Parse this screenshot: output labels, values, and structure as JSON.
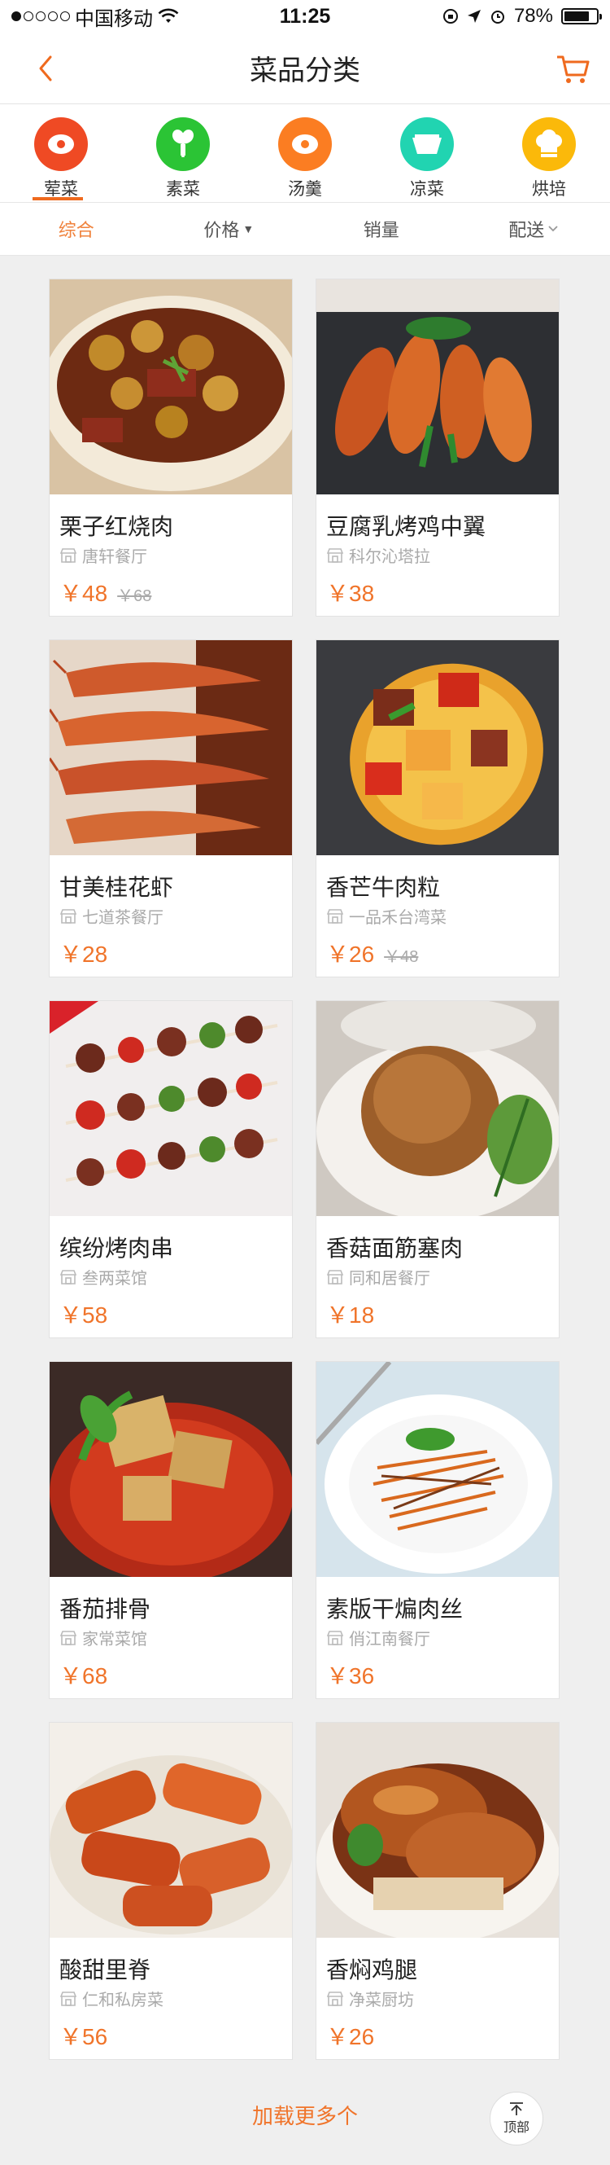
{
  "status": {
    "carrier": "中国移动",
    "time": "11:25",
    "battery": "78%",
    "battery_level": 0.78
  },
  "nav": {
    "title": "菜品分类",
    "back_icon": "chevron-left-icon",
    "cart_icon": "cart-icon",
    "accent": "#ef6a1e"
  },
  "categories": [
    {
      "label": "荤菜",
      "color": "#ef4a24",
      "icon": "meat-icon"
    },
    {
      "label": "素菜",
      "color": "#2bc435",
      "icon": "vegetable-icon"
    },
    {
      "label": "汤羹",
      "color": "#fb7d22",
      "icon": "soup-icon"
    },
    {
      "label": "凉菜",
      "color": "#21d4b1",
      "icon": "bowl-icon"
    },
    {
      "label": "烘培",
      "color": "#fbb90a",
      "icon": "chef-hat-icon"
    }
  ],
  "sort": {
    "items": [
      "综合",
      "价格",
      "销量",
      "配送"
    ],
    "active": "综合"
  },
  "dishes": [
    {
      "name": "栗子红烧肉",
      "shop": "唐轩餐厅",
      "price": "￥48",
      "old": "￥68"
    },
    {
      "name": "豆腐乳烤鸡中翼",
      "shop": "科尔沁塔拉",
      "price": "￥38",
      "old": ""
    },
    {
      "name": "甘美桂花虾",
      "shop": "七道茶餐厅",
      "price": "￥28",
      "old": ""
    },
    {
      "name": "香芒牛肉粒",
      "shop": "一品禾台湾菜",
      "price": "￥26",
      "old": "￥48"
    },
    {
      "name": "缤纷烤肉串",
      "shop": "叁两菜馆",
      "price": "￥58",
      "old": ""
    },
    {
      "name": "香菇面筋塞肉",
      "shop": "同和居餐厅",
      "price": "￥18",
      "old": ""
    },
    {
      "name": "番茄排骨",
      "shop": "家常菜馆",
      "price": "￥68",
      "old": ""
    },
    {
      "name": "素版干煸肉丝",
      "shop": "俏江南餐厅",
      "price": "￥36",
      "old": ""
    },
    {
      "name": "酸甜里脊",
      "shop": "仁和私房菜",
      "price": "￥56",
      "old": ""
    },
    {
      "name": "香焖鸡腿",
      "shop": "净菜厨坊",
      "price": "￥26",
      "old": ""
    }
  ],
  "load_more": "加载更多个",
  "to_top": "顶部"
}
